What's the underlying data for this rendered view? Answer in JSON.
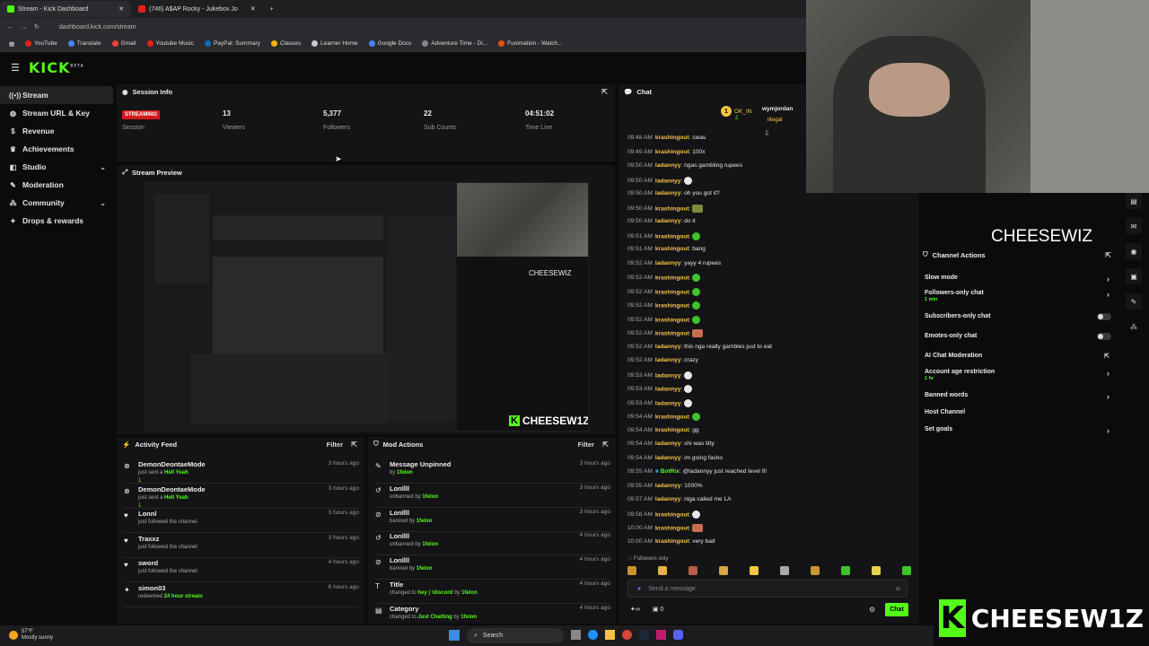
{
  "browser": {
    "tabs": [
      {
        "title": "Stream - Kick Dashboard",
        "color": "#53fc18"
      },
      {
        "title": "(746) A$AP Rocky - Jukebox Jo",
        "color": "#e62117"
      }
    ],
    "url": "dashboard.kick.com/stream",
    "bookmarks": [
      {
        "label": "YouTube",
        "color": "#e62117"
      },
      {
        "label": "Translate",
        "color": "#4285f4"
      },
      {
        "label": "Gmail",
        "color": "#ea4335"
      },
      {
        "label": "Youtube Music",
        "color": "#e62117"
      },
      {
        "label": "PayPal: Summary",
        "color": "#0070ba"
      },
      {
        "label": "Classes",
        "color": "#f4b400"
      },
      {
        "label": "Learner Home",
        "color": "#cccccc"
      },
      {
        "label": "Google Docs",
        "color": "#4285f4"
      },
      {
        "label": "Adventure Time - Di...",
        "color": "#888888"
      },
      {
        "label": "Funimation - Watch...",
        "color": "#e65100"
      }
    ]
  },
  "brand": {
    "logo": "KICK",
    "beta": "BETA",
    "accent": "#53fc18"
  },
  "sidebar": {
    "items": [
      {
        "label": "Stream",
        "icon": "broadcast-icon",
        "active": true
      },
      {
        "label": "Stream URL & Key",
        "icon": "globe-icon"
      },
      {
        "label": "Revenue",
        "icon": "dollar-icon"
      },
      {
        "label": "Achievements",
        "icon": "trophy-icon"
      },
      {
        "label": "Studio",
        "icon": "layers-icon",
        "chevron": true
      },
      {
        "label": "Moderation",
        "icon": "wrench-icon"
      },
      {
        "label": "Community",
        "icon": "users-icon",
        "chevron": true
      },
      {
        "label": "Drops & rewards",
        "icon": "gift-icon"
      }
    ]
  },
  "session": {
    "title": "Session Info",
    "status": "STREAMING",
    "status_label": "Session",
    "stats": [
      {
        "value": "13",
        "label": "Viewers"
      },
      {
        "value": "5,377",
        "label": "Followers"
      },
      {
        "value": "22",
        "label": "Sub Counts"
      },
      {
        "value": "04:51:02",
        "label": "Time Live"
      }
    ]
  },
  "preview": {
    "title": "Stream Preview",
    "overlay_name": "CHEESEW1Z",
    "cam_name": "CHEESEWIZ"
  },
  "activity": {
    "title": "Activity Feed",
    "filter": "Filter",
    "items": [
      {
        "name": "DemonDeontaeMode",
        "text": "just sent a",
        "highlight": "Hell Yeah",
        "sub": "1",
        "time": "3 hours ago",
        "icon": "kick-icon"
      },
      {
        "name": "DemonDeontaeMode",
        "text": "just sent a",
        "highlight": "Hell Yeah",
        "sub": "1",
        "time": "3 hours ago",
        "icon": "kick-icon"
      },
      {
        "name": "Lonnl",
        "text": "just followed the channel",
        "highlight": "",
        "time": "3 hours ago",
        "icon": "heart-icon"
      },
      {
        "name": "Traxxz",
        "text": "just followed the channel",
        "highlight": "",
        "time": "3 hours ago",
        "icon": "heart-icon"
      },
      {
        "name": "sword",
        "text": "just followed the channel",
        "highlight": "",
        "time": "4 hours ago",
        "icon": "heart-icon"
      },
      {
        "name": "simon03",
        "text": "redeemed",
        "highlight": "24 hour stream",
        "time": "6 hours ago",
        "icon": "gift-icon"
      }
    ]
  },
  "mod": {
    "title": "Mod Actions",
    "filter": "Filter",
    "items": [
      {
        "name": "Message Unpinned",
        "text": "by",
        "highlight": "1felon",
        "time": "3 hours ago",
        "icon": "pin-icon"
      },
      {
        "name": "Lonllll",
        "text": "unbanned by",
        "highlight": "1felon",
        "time": "3 hours ago",
        "icon": "undo-icon"
      },
      {
        "name": "Lonllll",
        "text": "banned by",
        "highlight": "1felon",
        "time": "3 hours ago",
        "icon": "ban-icon"
      },
      {
        "name": "Lonllll",
        "text": "unbanned by",
        "highlight": "1felon",
        "time": "4 hours ago",
        "icon": "undo-icon"
      },
      {
        "name": "Lonllll",
        "text": "banned by",
        "highlight": "1felon",
        "time": "4 hours ago",
        "icon": "ban-icon"
      },
      {
        "name": "Title",
        "text": "changed to",
        "highlight": "hey | !discord",
        "extra": "by",
        "extra_hl": "1felon",
        "time": "4 hours ago",
        "icon": "text-icon"
      },
      {
        "name": "Category",
        "text": "changed to",
        "highlight": "Just Chatting",
        "extra": "by",
        "extra_hl": "1felon",
        "time": "4 hours ago",
        "icon": "folder-icon"
      }
    ]
  },
  "chat": {
    "title": "Chat",
    "top_users": [
      {
        "rank": "1",
        "name": "OK_IN",
        "count": "2"
      },
      {
        "name": "wymjordan"
      },
      {
        "name": "illegal"
      }
    ],
    "messages": [
      {
        "time": "09:48 AM",
        "user": "krashingout",
        "text": "swas"
      },
      {
        "time": "09:49 AM",
        "user": "krashingout",
        "text": "100x"
      },
      {
        "time": "09:50 AM",
        "user": "ladannyy",
        "text": "ngas gambling rupees"
      },
      {
        "time": "09:50 AM",
        "user": "ladannyy",
        "text": "",
        "emote": "w"
      },
      {
        "time": "09:50 AM",
        "user": "ladannyy",
        "text": "oh you got it?"
      },
      {
        "time": "09:50 AM",
        "user": "krashingout",
        "text": "",
        "emote": "m"
      },
      {
        "time": "09:50 AM",
        "user": "ladannyy",
        "text": "do it"
      },
      {
        "time": "09:51 AM",
        "user": "krashingout",
        "text": "",
        "emote": "g"
      },
      {
        "time": "09:51 AM",
        "user": "krashingout",
        "text": "bang"
      },
      {
        "time": "09:52 AM",
        "user": "ladannyy",
        "text": "yayy 4 rupees"
      },
      {
        "time": "09:52 AM",
        "user": "krashingout",
        "text": "",
        "emote": "g"
      },
      {
        "time": "09:52 AM",
        "user": "krashingout",
        "text": "",
        "emote": "g"
      },
      {
        "time": "09:52 AM",
        "user": "krashingout",
        "text": "",
        "emote": "g"
      },
      {
        "time": "09:52 AM",
        "user": "krashingout",
        "text": "",
        "emote": "g"
      },
      {
        "time": "09:52 AM",
        "user": "krashingout",
        "text": "",
        "emote": "p"
      },
      {
        "time": "09:52 AM",
        "user": "ladannyy",
        "text": "this nga really gambles just to eat"
      },
      {
        "time": "09:52 AM",
        "user": "ladannyy",
        "text": "crazy"
      },
      {
        "time": "09:53 AM",
        "user": "ladannyy",
        "text": "",
        "emote": "w"
      },
      {
        "time": "09:53 AM",
        "user": "ladannyy",
        "text": "",
        "emote": "w"
      },
      {
        "time": "09:53 AM",
        "user": "ladannyy",
        "text": "",
        "emote": "w"
      },
      {
        "time": "09:54 AM",
        "user": "krashingout",
        "text": "",
        "emote": "g"
      },
      {
        "time": "09:54 AM",
        "user": "krashingout",
        "text": "gg"
      },
      {
        "time": "09:54 AM",
        "user": "ladannyy",
        "text": "shi was litty"
      },
      {
        "time": "09:54 AM",
        "user": "ladannyy",
        "text": "im going fasho"
      },
      {
        "time": "09:55 AM",
        "user": "BotRix",
        "text": "@ladannyy just reached level 9!",
        "bot": true
      },
      {
        "time": "09:55 AM",
        "user": "ladannyy",
        "text": "1000%"
      },
      {
        "time": "09:57 AM",
        "user": "ladannyy",
        "text": "niga called me LA"
      },
      {
        "time": "09:58 AM",
        "user": "krashingout",
        "text": "",
        "emote": "w"
      },
      {
        "time": "10:00 AM",
        "user": "krashingout",
        "text": "",
        "emote": "p"
      },
      {
        "time": "10:00 AM",
        "user": "krashingout",
        "text": "very bad"
      }
    ],
    "mode": "Followers only",
    "placeholder": "Send a message",
    "send": "Chat",
    "points": "0"
  },
  "channel": {
    "cam_name": "CHEESEWIZ",
    "title": "Channel Actions",
    "actions": [
      {
        "label": "Slow mode",
        "type": "chevron"
      },
      {
        "label": "Followers-only chat",
        "sub": "1 min",
        "type": "chevron"
      },
      {
        "label": "Subscribers-only chat",
        "type": "toggle"
      },
      {
        "label": "Emotes-only chat",
        "type": "toggle"
      },
      {
        "label": "AI Chat Moderation",
        "type": "external"
      },
      {
        "label": "Account age restriction",
        "sub": "1 hr",
        "type": "chevron"
      },
      {
        "label": "Banned words",
        "type": "chevron"
      },
      {
        "label": "Host Channel",
        "type": "none"
      },
      {
        "label": "Set goals",
        "type": "chevron"
      }
    ]
  },
  "taskbar": {
    "temp": "57°F",
    "weather": "Mostly sunny",
    "search": "Search"
  },
  "watermark": "CHEESEW1Z"
}
